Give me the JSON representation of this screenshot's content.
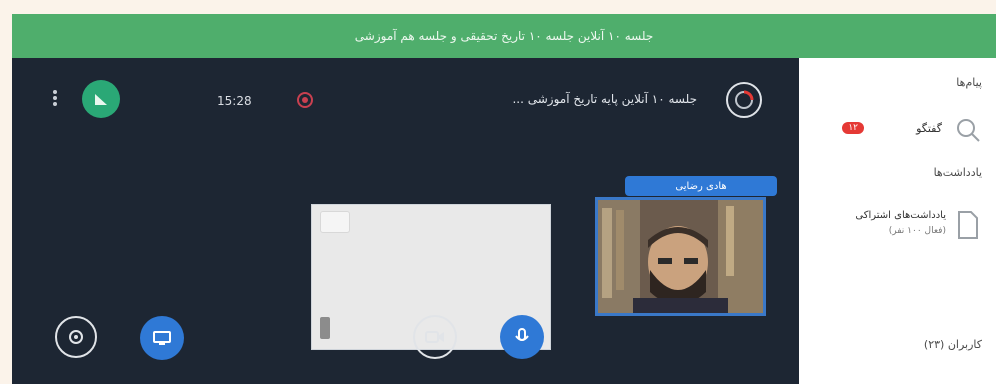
{
  "banner": {
    "text": "جلسه ۱۰ آنلاین جلسه ۱۰ تاریخ تحقیقی و جلسه هم آموزشی"
  },
  "stage": {
    "timer": "15:28",
    "meeting_title": "جلسه ۱۰ آنلاین پایه تاریخ آموزشی ..."
  },
  "participant": {
    "name": "هادی رضایی"
  },
  "sidebar": {
    "section_title": "پیام‌ها",
    "chat_item_label": "گفتگو",
    "chat_unread": "۱۲",
    "notes_title": "یادداشت‌ها",
    "notes_item_label": "یادداشت‌های اشتراکی",
    "notes_item_sub": "(فعال ۱۰۰ نفر)",
    "users_title": "کاربران (۲۳)"
  },
  "colors": {
    "banner": "#4fae6c",
    "stage": "#1d2633",
    "accent_blue": "#2f79d6",
    "badge_red": "#e53935"
  }
}
